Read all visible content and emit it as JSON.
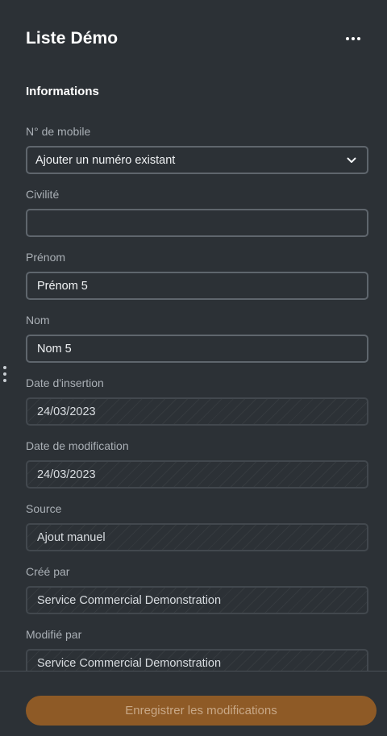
{
  "header": {
    "title": "Liste Démo",
    "more_icon": "more-horizontal-icon"
  },
  "section": {
    "title": "Informations"
  },
  "fields": {
    "mobile": {
      "label": "N° de mobile",
      "value": "Ajouter un numéro existant",
      "icon": "chevron-down-icon"
    },
    "civilite": {
      "label": "Civilité",
      "value": ""
    },
    "prenom": {
      "label": "Prénom",
      "value": "Prénom 5"
    },
    "nom": {
      "label": "Nom",
      "value": "Nom 5"
    },
    "date_insertion": {
      "label": "Date d'insertion",
      "value": "24/03/2023"
    },
    "date_modification": {
      "label": "Date de modification",
      "value": "24/03/2023"
    },
    "source": {
      "label": "Source",
      "value": "Ajout manuel"
    },
    "cree_par": {
      "label": "Créé par",
      "value": "Service Commercial Demonstration"
    },
    "modifie_par": {
      "label": "Modifié par",
      "value": "Service Commercial Demonstration"
    }
  },
  "footer": {
    "save_label": "Enregistrer les modifications"
  },
  "colors": {
    "background": "#2c3136",
    "accent": "#8e5a26"
  }
}
